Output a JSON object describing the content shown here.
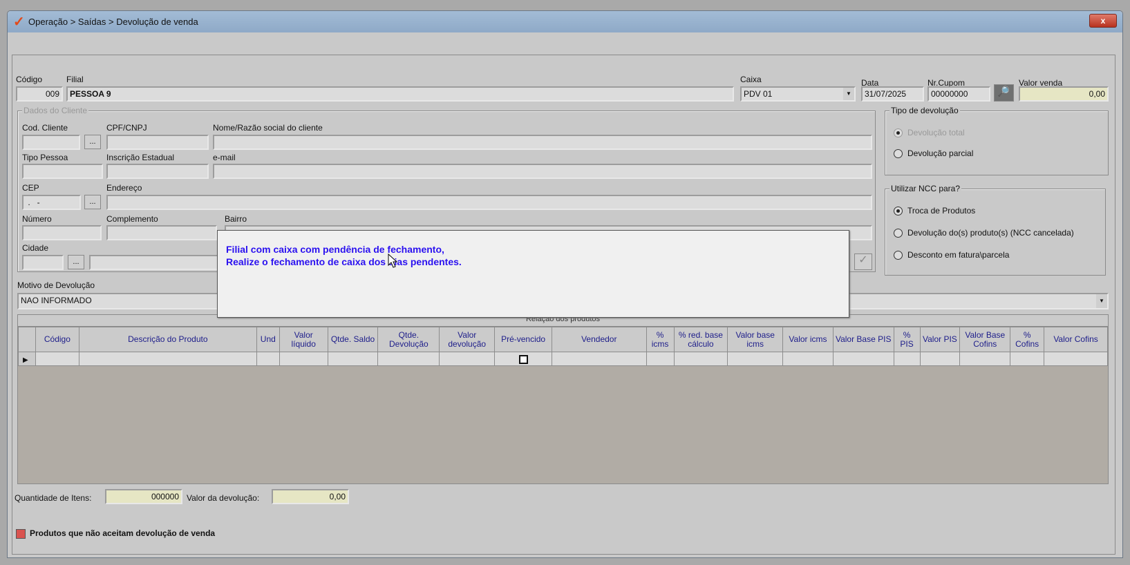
{
  "window": {
    "title": "Operação > Saídas > Devolução de venda",
    "close": "x"
  },
  "header": {
    "codigo_label": "Código",
    "codigo_value": "009",
    "filial_label": "Filial",
    "filial_value": "PESSOA 9",
    "caixa_label": "Caixa",
    "caixa_value": "PDV 01",
    "data_label": "Data",
    "data_value": "31/07/2025",
    "cupom_label": "Nr.Cupom",
    "cupom_value": "00000000",
    "valor_venda_label": "Valor venda",
    "valor_venda_value": "0,00"
  },
  "cliente": {
    "group": "Dados do Cliente",
    "cod_label": "Cod. Cliente",
    "cpf_label": "CPF/CNPJ",
    "nome_label": "Nome/Razão social do cliente",
    "tipo_label": "Tipo Pessoa",
    "ie_label": "Inscrição Estadual",
    "email_label": "e-mail",
    "cep_label": "CEP",
    "cep_value": " .   -",
    "endereco_label": "Endereço",
    "numero_label": "Número",
    "complemento_label": "Complemento",
    "bairro_label": "Bairro",
    "cidade_label": "Cidade",
    "ellipsis": "..."
  },
  "tipo_devolucao": {
    "group": "Tipo de devolução",
    "options": [
      "Devolução total",
      "Devolução parcial"
    ]
  },
  "ncc": {
    "group": "Utilizar NCC para?",
    "options": [
      "Troca de Produtos",
      "Devolução do(s) produto(s) (NCC cancelada)",
      "Desconto em fatura\\parcela"
    ]
  },
  "motivo": {
    "label": "Motivo de Devolução",
    "value": "NAO INFORMADO"
  },
  "grid": {
    "caption": "Relação dos produtos",
    "columns": [
      "",
      "Código",
      "Descrição do Produto",
      "Und",
      "Valor líquido",
      "Qtde. Saldo",
      "Qtde. Devolução",
      "Valor devolução",
      "Pré-vencido",
      "Vendedor",
      "% icms",
      "% red. base cálculo",
      "Valor base icms",
      "Valor icms",
      "Valor Base PIS",
      "% PIS",
      "Valor PIS",
      "Valor Base Cofins",
      "% Cofins",
      "Valor Cofins"
    ]
  },
  "footer": {
    "qtd_label": "Quantidade de Itens:",
    "qtd_value": "000000",
    "valor_label": "Valor da devolução:",
    "valor_value": "0,00",
    "legend": "Produtos que não aceitam devolução de venda"
  },
  "dialog": {
    "line1": "Filial com caixa com pendência de fechamento,",
    "line2": "Realize o fechamento de caixa dos dias pendentes."
  },
  "colors": {
    "dialog_text": "#2a10f0",
    "legend_red": "#d9534f",
    "highlight": "#e6e6c4"
  }
}
